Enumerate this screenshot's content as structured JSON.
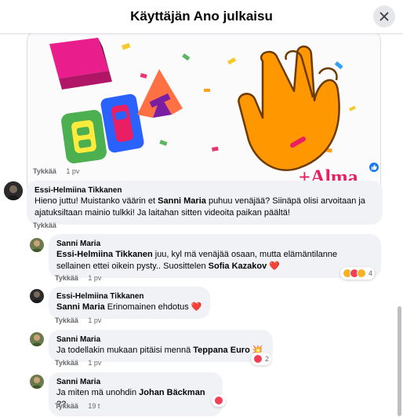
{
  "header": {
    "title": "Käyttäjän Ano julkaisu"
  },
  "gif": {
    "caption": "+Alma"
  },
  "post_actions": {
    "like_label": "Tykkää",
    "time": "1 pv"
  },
  "comments": [
    {
      "author": "Essi-Helmiina Tikkanen",
      "text_parts": [
        "Hieno juttu! Muistanko väärin et ",
        "Sanni Maria",
        " puhuu venäjää? Siinäpä olisi arvoitaan ja ajatuksiltaan mainio tulkki! Ja laitahan sitten videoita paikan päältä!"
      ],
      "like_label": "Tykkää",
      "time": "1 pv"
    },
    {
      "author": "Sanni Maria",
      "text_parts": [
        "Essi-Helmiina Tikkanen",
        " juu, kyl mä venäjää osaan, mutta elämäntilanne sellainen ettei oikein pysty.. Suosittelen ",
        "Sofia Kazakov",
        " ❤️"
      ],
      "like_label": "Tykkää",
      "time": "1 pv",
      "reaction_count": "4"
    },
    {
      "author": "Essi-Helmiina Tikkanen",
      "text_parts": [
        "Sanni Maria",
        " Erinomainen ehdotus ❤️"
      ],
      "like_label": "Tykkää",
      "time": "1 pv"
    },
    {
      "author": "Sanni Maria",
      "text_parts": [
        "Ja todellakin mukaan pitäisi mennä ",
        "Teppana Euro",
        " 💥"
      ],
      "like_label": "Tykkää",
      "time": "1 pv",
      "reaction_count": "2"
    },
    {
      "author": "Sanni Maria",
      "text_parts": [
        "Ja miten mä unohdin ",
        "Johan Bäckman",
        " ??"
      ],
      "like_label": "Tykkää",
      "time": "19 t"
    }
  ],
  "colors": {
    "like_blue": "#1877f2",
    "love_red": "#f33e58",
    "haha_yellow": "#f7b125",
    "close_bg": "#e4e6eb"
  },
  "icons": {
    "close": "close-icon",
    "like": "like-reaction-icon",
    "love": "love-reaction-icon",
    "haha": "haha-reaction-icon"
  }
}
